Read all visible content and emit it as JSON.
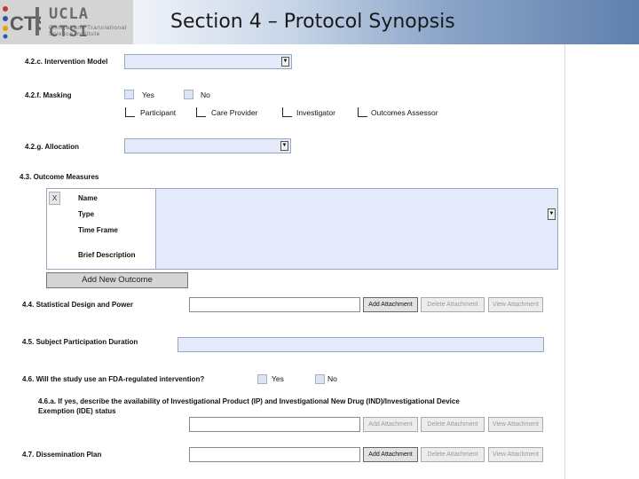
{
  "header": {
    "logo_title": "UCLA CTSI",
    "logo_subtitle": "Clinical and Translational Science Institute",
    "slide_title": "Section 4 – Protocol Synopsis"
  },
  "form": {
    "intervention_model": {
      "label": "4.2.c. Intervention Model",
      "value": ""
    },
    "masking": {
      "label": "4.2.f. Masking",
      "yes": "Yes",
      "no": "No",
      "roles": [
        "Participant",
        "Care Provider",
        "Investigator",
        "Outcomes Assessor"
      ]
    },
    "allocation": {
      "label": "4.2.g. Allocation",
      "value": ""
    },
    "outcome_measures": {
      "label": "4.3. Outcome Measures",
      "remove_label": "X",
      "fields": [
        "Name",
        "Type",
        "Time Frame",
        "Brief Description"
      ],
      "add_button": "Add New Outcome"
    },
    "statistical_design": {
      "label": "4.4. Statistical Design and Power"
    },
    "participation_duration": {
      "label": "4.5. Subject Participation Duration"
    },
    "fda_regulated": {
      "label": "4.6. Will the study use an FDA-regulated intervention?",
      "yes": "Yes",
      "no": "No"
    },
    "ip_availability": {
      "label": "4.6.a. If yes, describe the availability of Investigational Product (IP) and Investigational New Drug (IND)/Investigational Device Exemption (IDE) status"
    },
    "dissemination_plan": {
      "label": "4.7. Dissemination Plan"
    },
    "buttons": {
      "add_attachment": "Add Attachment",
      "delete_attachment": "Delete Attachment",
      "view_attachment": "View Attachment"
    }
  }
}
